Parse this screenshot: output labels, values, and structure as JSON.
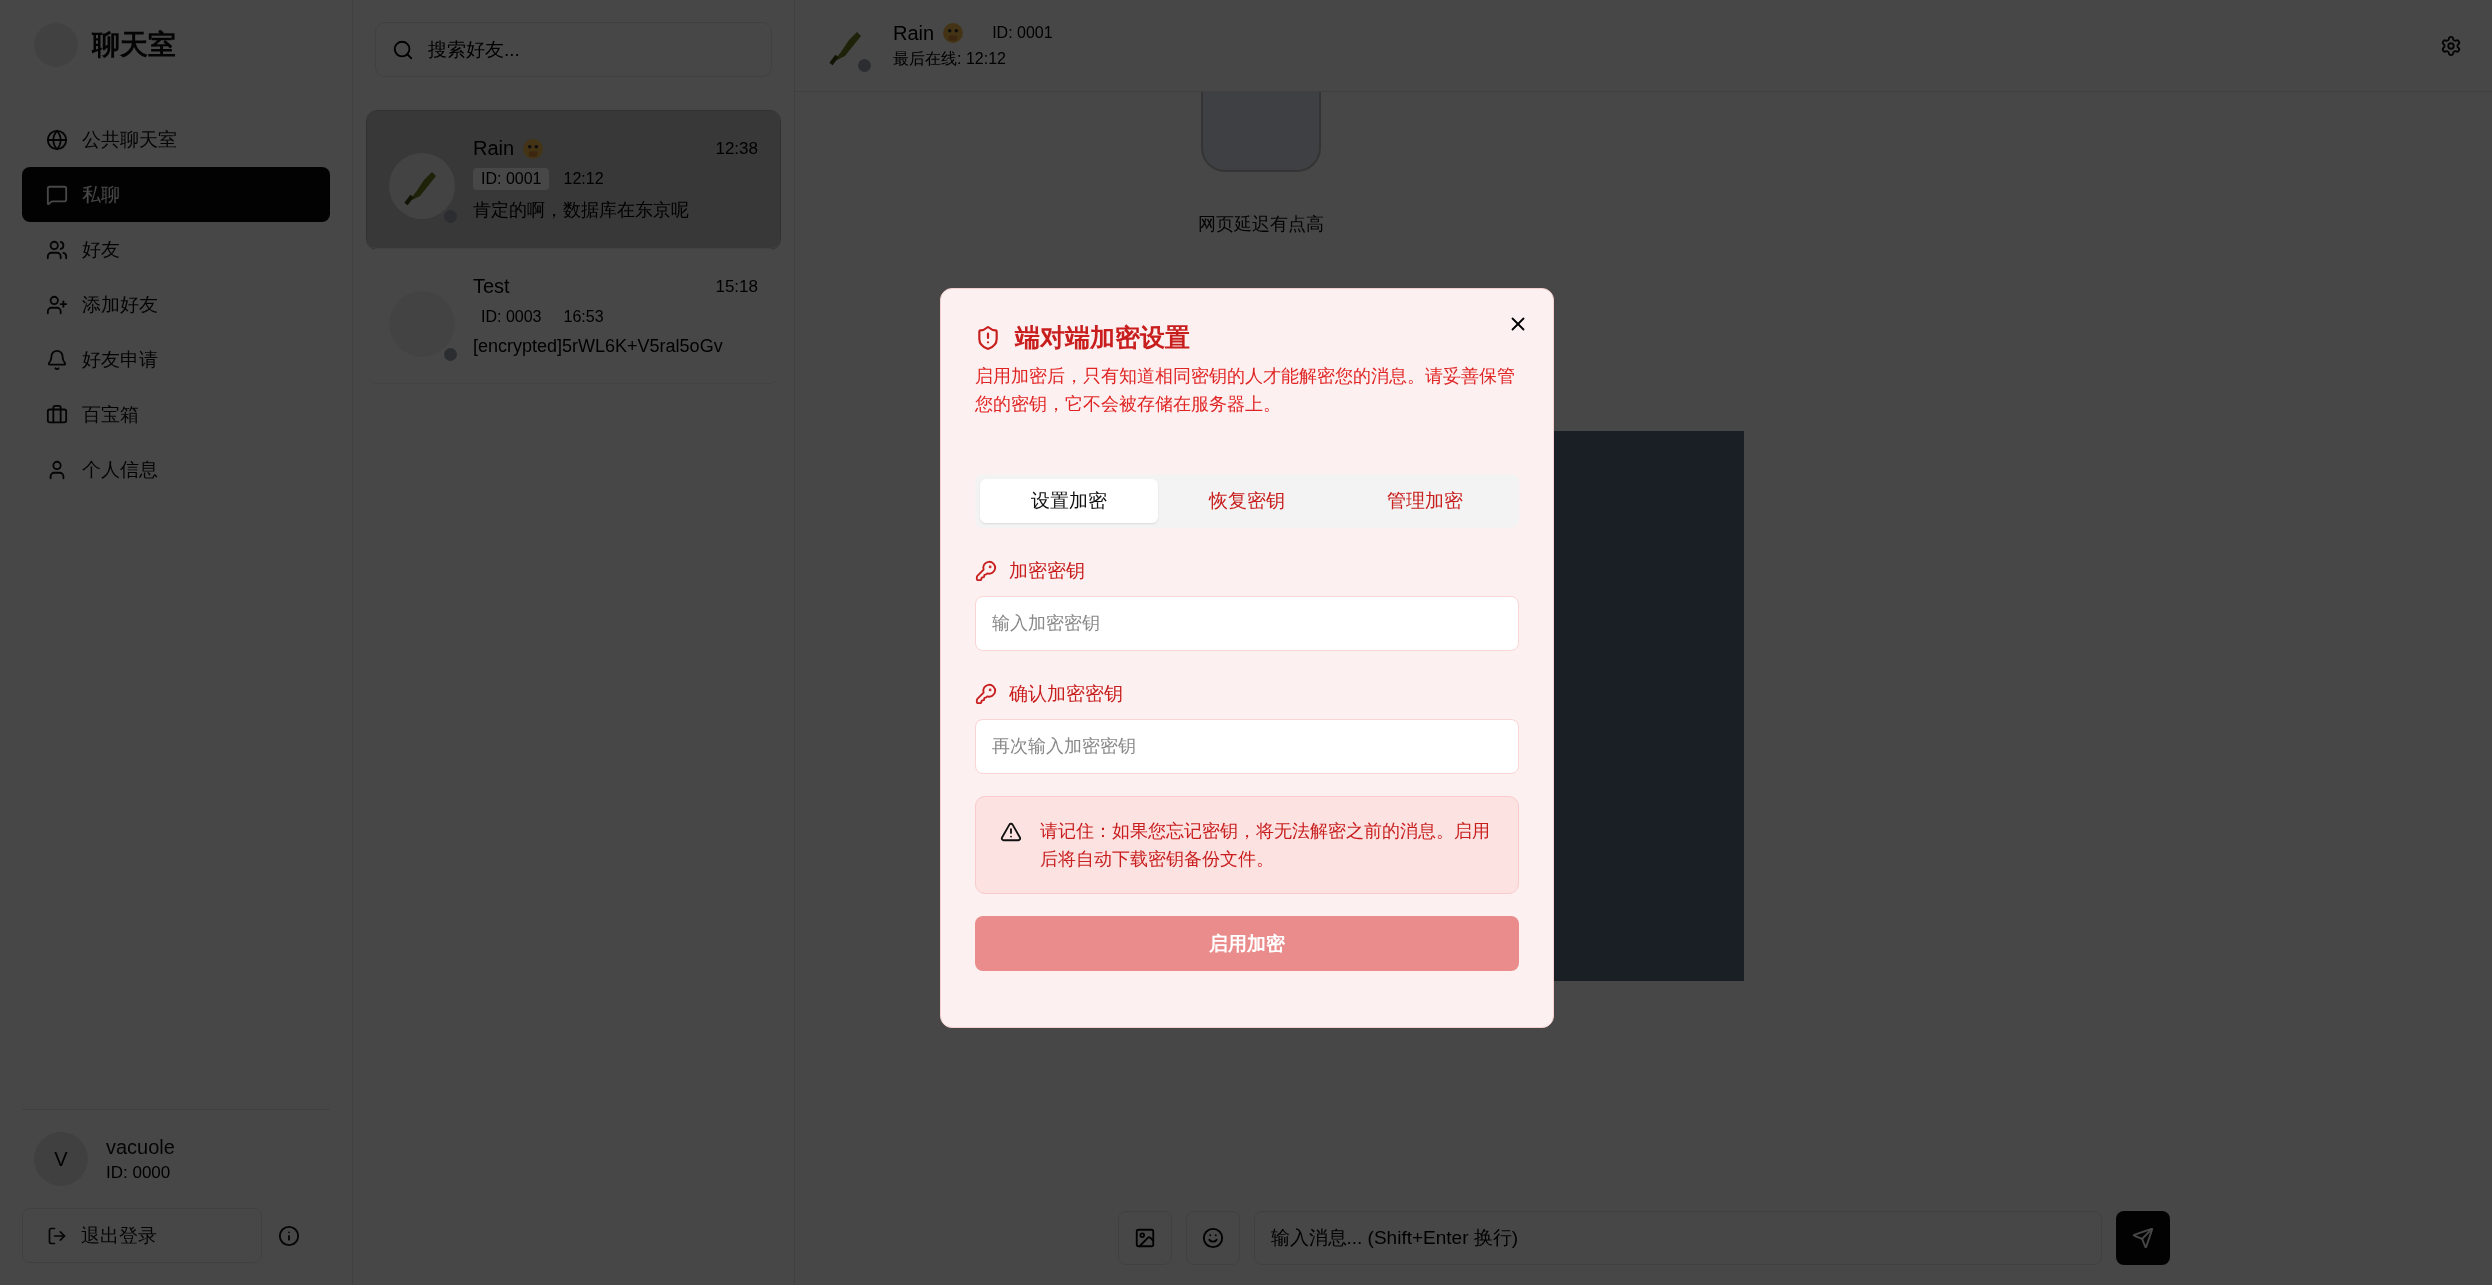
{
  "app": {
    "title": "聊天室"
  },
  "nav": [
    {
      "label": "公共聊天室",
      "selected": false
    },
    {
      "label": "私聊",
      "selected": true
    },
    {
      "label": "好友",
      "selected": false
    },
    {
      "label": "添加好友",
      "selected": false
    },
    {
      "label": "好友申请",
      "selected": false
    },
    {
      "label": "百宝箱",
      "selected": false
    },
    {
      "label": "个人信息",
      "selected": false
    }
  ],
  "user": {
    "avatar": "V",
    "name": "vacuole",
    "id": "ID: 0000"
  },
  "logout": "退出登录",
  "search": {
    "placeholder": "搜索好友..."
  },
  "conversations": [
    {
      "name": "Rain",
      "time": "12:38",
      "id": "ID: 0001",
      "last_seen": "12:12",
      "preview": "肯定的啊，数据库在东京呢",
      "selected": true,
      "kind": "picture",
      "online": false
    },
    {
      "name": "Test",
      "time": "15:18",
      "id": "ID: 0003",
      "last_seen": "16:53",
      "preview": "[encrypted]5rWL6K+V5ral5oGv",
      "selected": false,
      "kind": "blank",
      "online": false
    }
  ],
  "chat": {
    "name": "Rain",
    "id": "ID: 0001",
    "status": "最后在线: 12:12",
    "online": false
  },
  "messages": [
    {
      "kind": "sticker",
      "caption": "网页延迟有点高"
    },
    {
      "kind": "image"
    }
  ],
  "composer": {
    "placeholder": "输入消息... (Shift+Enter 换行)"
  },
  "dialog": {
    "title": "端对端加密设置",
    "description": "启用加密后，只有知道相同密钥的人才能解密您的消息。请妥善保管您的密钥，它不会被存储在服务器上。",
    "tabs": [
      {
        "label": "设置加密",
        "selected": true
      },
      {
        "label": "恢复密钥",
        "selected": false
      },
      {
        "label": "管理加密",
        "selected": false
      }
    ],
    "fields": [
      {
        "label": "加密密钥",
        "placeholder": "输入加密密钥"
      },
      {
        "label": "确认加密密钥",
        "placeholder": "再次输入加密密钥"
      }
    ],
    "warning": "请记住：如果您忘记密钥，将无法解密之前的消息。启用后将自动下载密钥备份文件。",
    "submit": {
      "label": "启用加密",
      "disabled": true
    }
  }
}
